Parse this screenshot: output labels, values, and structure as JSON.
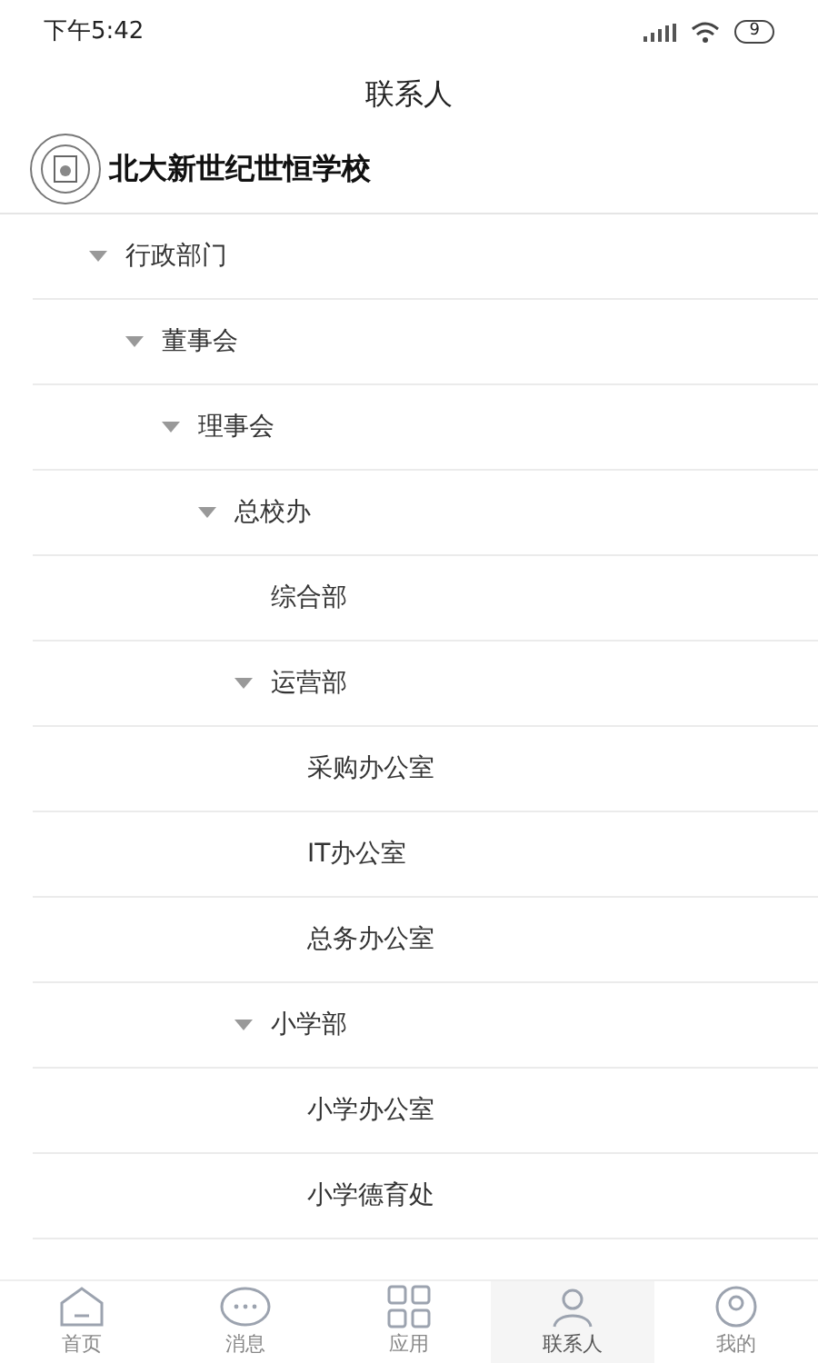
{
  "status_bar": {
    "time": "下午5:42",
    "battery": "9"
  },
  "header": {
    "title": "联系人"
  },
  "organization": {
    "name": "北大新世纪世恒学校"
  },
  "tree": [
    {
      "label": "行政部门",
      "expanded": true,
      "children": [
        {
          "label": "董事会",
          "expanded": true,
          "children": [
            {
              "label": "理事会",
              "expanded": true,
              "children": [
                {
                  "label": "总校办",
                  "expanded": true,
                  "children": [
                    {
                      "label": "综合部"
                    },
                    {
                      "label": "运营部",
                      "expanded": true,
                      "children": [
                        {
                          "label": "采购办公室"
                        },
                        {
                          "label": "IT办公室"
                        },
                        {
                          "label": "总务办公室"
                        }
                      ]
                    },
                    {
                      "label": "小学部",
                      "expanded": true,
                      "children": [
                        {
                          "label": "小学办公室"
                        },
                        {
                          "label": "小学德育处"
                        }
                      ]
                    }
                  ]
                }
              ]
            }
          ]
        }
      ]
    }
  ],
  "tab_bar": [
    {
      "label": "首页",
      "kind": "home",
      "selected": false
    },
    {
      "label": "消息",
      "kind": "message",
      "selected": false
    },
    {
      "label": "应用",
      "kind": "apps",
      "selected": false
    },
    {
      "label": "联系人",
      "kind": "contacts",
      "selected": true
    },
    {
      "label": "我的",
      "kind": "profile",
      "selected": false
    }
  ]
}
